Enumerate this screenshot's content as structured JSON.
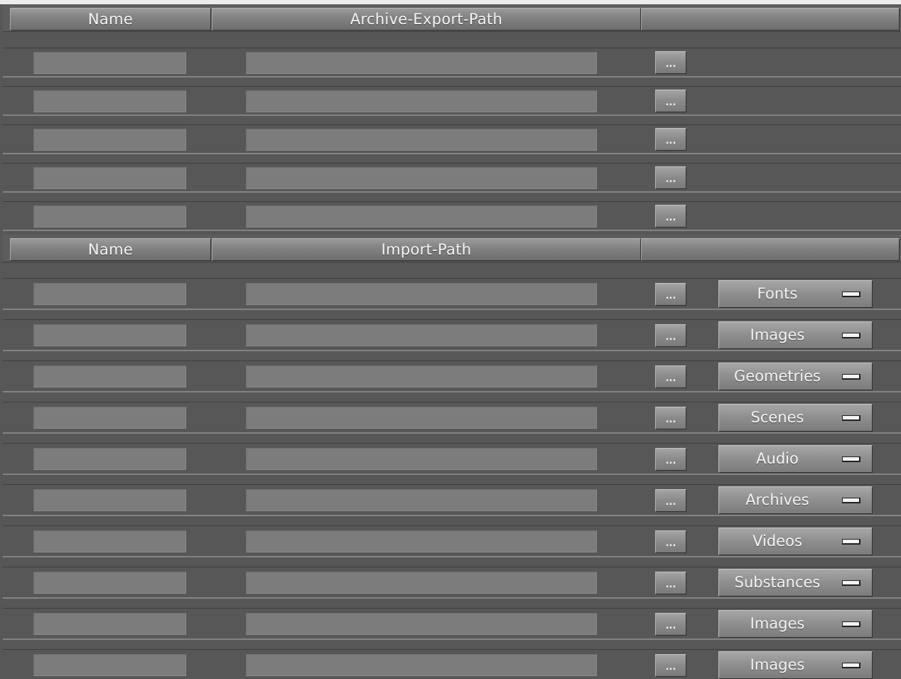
{
  "export_section": {
    "headers": {
      "name": "Name",
      "path": "Archive-Export-Path",
      "actions": ""
    },
    "rows": [
      {
        "name": "",
        "path": "",
        "browse_label": "..."
      },
      {
        "name": "",
        "path": "",
        "browse_label": "..."
      },
      {
        "name": "",
        "path": "",
        "browse_label": "..."
      },
      {
        "name": "",
        "path": "",
        "browse_label": "..."
      },
      {
        "name": "",
        "path": "",
        "browse_label": "..."
      }
    ]
  },
  "import_section": {
    "headers": {
      "name": "Name",
      "path": "Import-Path",
      "actions": ""
    },
    "rows": [
      {
        "name": "",
        "path": "",
        "browse_label": "...",
        "type": "Fonts"
      },
      {
        "name": "",
        "path": "",
        "browse_label": "...",
        "type": "Images"
      },
      {
        "name": "",
        "path": "",
        "browse_label": "...",
        "type": "Geometries"
      },
      {
        "name": "",
        "path": "",
        "browse_label": "...",
        "type": "Scenes"
      },
      {
        "name": "",
        "path": "",
        "browse_label": "...",
        "type": "Audio"
      },
      {
        "name": "",
        "path": "",
        "browse_label": "...",
        "type": "Archives"
      },
      {
        "name": "",
        "path": "",
        "browse_label": "...",
        "type": "Videos"
      },
      {
        "name": "",
        "path": "",
        "browse_label": "...",
        "type": "Substances"
      },
      {
        "name": "",
        "path": "",
        "browse_label": "...",
        "type": "Images"
      },
      {
        "name": "",
        "path": "",
        "browse_label": "...",
        "type": "Images"
      }
    ]
  },
  "colors": {
    "background": "#575757",
    "field": "#7c7c7c",
    "header_text": "#f4f4f4",
    "indicator": "#f2f2f2"
  }
}
